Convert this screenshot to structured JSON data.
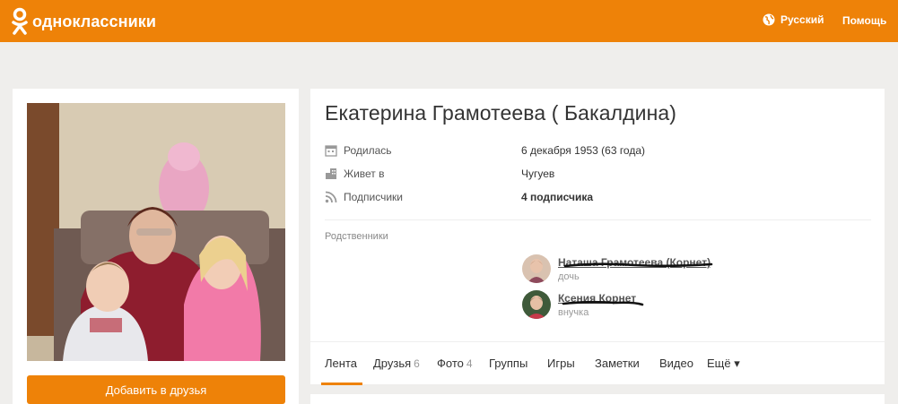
{
  "brand": {
    "name": "одноклассники",
    "color": "#ee8208"
  },
  "header": {
    "language": "Русский",
    "help": "Помощь"
  },
  "profile": {
    "name": "Екатерина Грамотеева ( Бакалдина)",
    "add_friend": "Добавить в друзья",
    "info": [
      {
        "icon": "calendar-icon",
        "label": "Родилась",
        "value": "6 декабря 1953 (63 года)",
        "bold": false
      },
      {
        "icon": "building-icon",
        "label": "Живет в",
        "value": "Чугуев",
        "bold": false
      },
      {
        "icon": "rss-icon",
        "label": "Подписчики",
        "value": "4 подписчика",
        "bold": true
      }
    ],
    "relatives_heading": "Родственники",
    "relatives": [
      {
        "name": "Наташа Грамотеева (Корнет)",
        "relation": "дочь"
      },
      {
        "name": "Ксения Корнет",
        "relation": "внучка"
      }
    ]
  },
  "tabs": [
    {
      "label": "Лента",
      "count": "",
      "active": true
    },
    {
      "label": "Друзья",
      "count": "6"
    },
    {
      "label": "Фото",
      "count": "4"
    },
    {
      "label": "Группы",
      "count": ""
    },
    {
      "label": "Игры",
      "count": ""
    },
    {
      "label": "Заметки",
      "count": ""
    },
    {
      "label": "Видео",
      "count": ""
    },
    {
      "label": "Ещё ▾",
      "count": ""
    }
  ]
}
